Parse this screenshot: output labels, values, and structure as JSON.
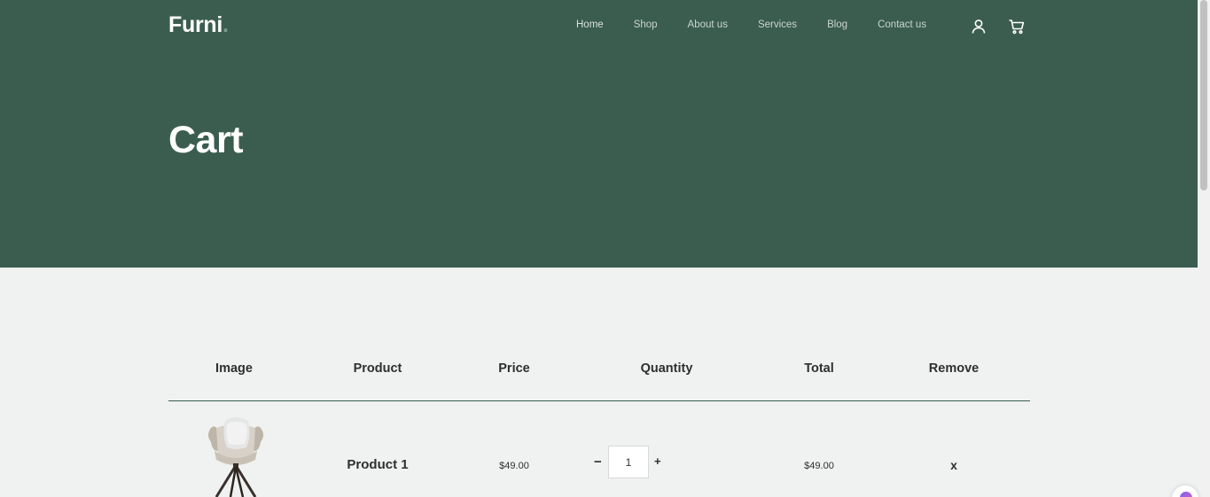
{
  "brand": {
    "name": "Furni",
    "dot": "."
  },
  "nav": {
    "items": [
      {
        "label": "Home"
      },
      {
        "label": "Shop"
      },
      {
        "label": "About us"
      },
      {
        "label": "Services"
      },
      {
        "label": "Blog"
      },
      {
        "label": "Contact us"
      }
    ],
    "user_icon": "user-icon",
    "cart_icon": "cart-icon"
  },
  "hero": {
    "title": "Cart"
  },
  "table": {
    "headers": {
      "image": "Image",
      "product": "Product",
      "price": "Price",
      "quantity": "Quantity",
      "total": "Total",
      "remove": "Remove"
    },
    "rows": [
      {
        "image": "chair",
        "product": "Product 1",
        "price": "$49.00",
        "minus": "−",
        "quantity": "1",
        "plus": "+",
        "total": "$49.00",
        "remove": "x"
      }
    ]
  },
  "colors": {
    "header_bg": "#3b5d50",
    "page_bg": "#eff2f1",
    "text_dark": "#2f2f2f"
  }
}
